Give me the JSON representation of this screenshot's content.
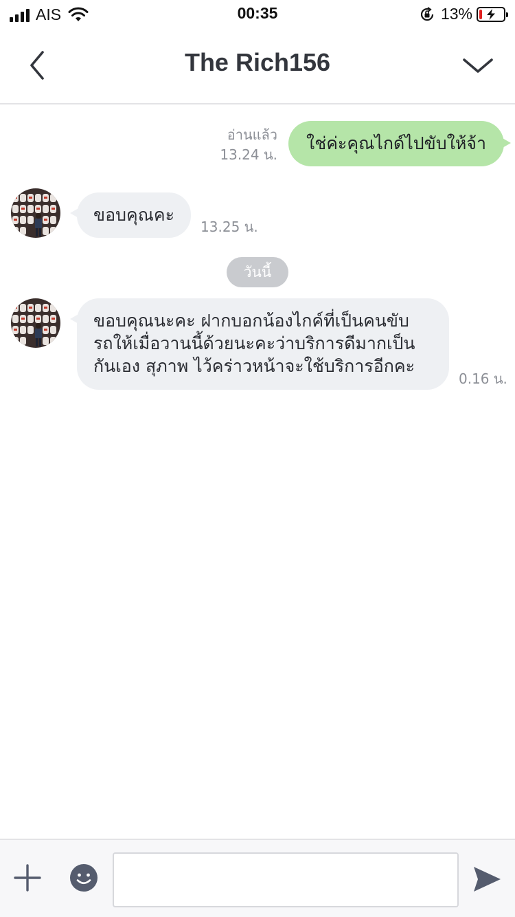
{
  "status_bar": {
    "carrier": "AIS",
    "time": "00:35",
    "battery_percent": "13%",
    "battery_level": 0.13,
    "icons": [
      "signal-bars-icon",
      "wifi-icon",
      "orientation-lock-icon",
      "battery-charging-icon"
    ]
  },
  "header": {
    "title": "The Rich156",
    "icons": {
      "back": "chevron-left-icon",
      "menu": "chevron-down-icon"
    }
  },
  "messages": [
    {
      "direction": "sent",
      "text": "ใช่ค่ะคุณไกด์ไปขับให้จ้า",
      "read_label": "อ่านแล้ว",
      "time": "13.24 น."
    },
    {
      "direction": "received",
      "lines": [
        "ขอบคุณคะ"
      ],
      "time": "13.25 น."
    },
    {
      "direction": "received",
      "lines": [
        "ขอบคุณนะคะ ฝากบอกน้องไกค์ที่เป็นคนขับ",
        "รถให้เมื่อวานนี้ด้วยนะคะว่าบริการดีมากเป็น",
        "กันเอง สุภาพ ไว้คร่าวหน้าจะใช้บริการอีกคะ"
      ],
      "time": "0.16 น."
    }
  ],
  "date_separator": "วันนี้",
  "input_bar": {
    "placeholder": "",
    "value": "",
    "icons": {
      "attach": "plus-icon",
      "sticker": "emoji-icon",
      "send": "send-icon"
    }
  },
  "colors": {
    "sent_bubble": "#b5e5a8",
    "received_bubble": "#eef0f3",
    "date_chip": "#c9cbcf",
    "battery_low": "#e02020",
    "icon_gray": "#555c6e"
  }
}
